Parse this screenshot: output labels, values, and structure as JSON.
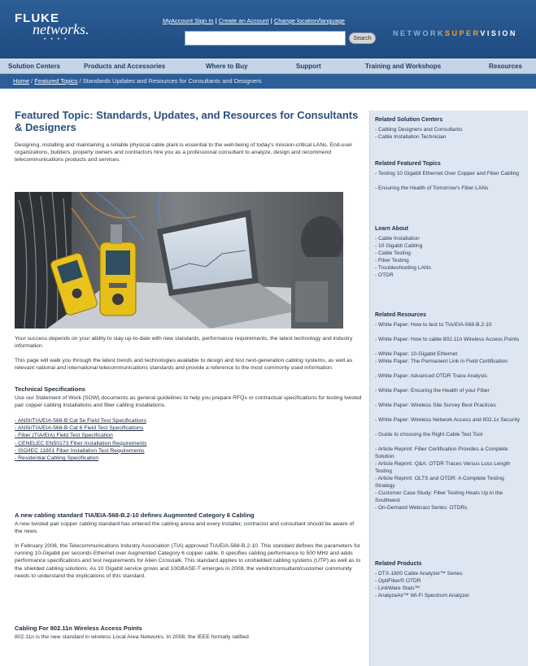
{
  "header": {
    "logo_top": "FLUKE",
    "logo_bottom": "networks.",
    "logo_dots": "• • • •",
    "links": [
      {
        "label": "MyAccount Sign In"
      },
      {
        "label": "Create an Account"
      },
      {
        "label": "Change location/language"
      }
    ],
    "link_separator": " | ",
    "search_placeholder": "",
    "search_button": "Search",
    "nsv_prefix": "NETWORK",
    "nsv_super": "SUPER",
    "nsv_vision": "VISION"
  },
  "nav": {
    "items": [
      "Solution Centers",
      "Products and Accessories",
      "Where to Buy",
      "Support",
      "Training and Workshops",
      "Resources"
    ]
  },
  "breadcrumb": {
    "home": "Home",
    "sep": " / ",
    "featured": "Featured Topics",
    "current": "Standards Updates and Resources for Consultants and Designers"
  },
  "main": {
    "title": "Featured Topic: Standards, Updates, and Resources for Consultants & Designers",
    "intro": "Designing, installing and maintaining a reliable physical cable plant is essential to the well-being of today's mission-critical LANs. End-user organizations, builders, property owners and contractors hire you as a professional consultant to analyze, design and recommend telecommunications products and services.",
    "p1": "Your success depends on your ability to stay up-to-date with new standards, performance requirements, the latest technology and industry information.",
    "p2": "This page will walk you through the latest trends and technologies available to design and test next-generation cabling systems, as well as relevant national and international telecommunications standards and provide a reference to the most commonly used information.",
    "tech_title": "Technical Specifications",
    "tech_body": "Use our Statement of Work (SOW) documents as general guidelines to help you prepare RFQs or contractual specifications for testing twisted pair copper cabling installations and fiber cabling installations.",
    "tech_links": [
      "- ANSI/TIA/EIA-568-B Cat 5e Field Test Specifications",
      "- ANSI/TIA/EIA-568-B Cat 6 Field Test Specifications",
      "- Fiber (TIA/EIA) Field Test Specification",
      "- CENELEC EN50173 Fiber Installation Requirements",
      "- ISO/IEC 11801 Fiber Installation Test Requirements",
      "- Residential Cabling Specification"
    ],
    "cat6_title": "A new cabling standard TIA/EIA-568-B.2-10 defines Augmented Category 6 Cabling",
    "cat6_body": "A new twisted pair copper cabling standard has entered the cabling arena and every installer, contractor and consultant should be aware of the news.",
    "cat6_body2": "In February 2008, the Telecommunications Industry Association (TIA) approved TIA/EIA-568-B.2-10. This standard defines the parameters for running 10-Gigabit per seconds Ethernet over Augmented Category 6 copper cable. It specifies cabling performance to 500 MHz and adds performance specifications and test requirements for Alien Crosstalk. This standard applies to unshielded cabling systems (UTP) as well as to the shielded cabling solutions. As 10 Gigabit service grows and 10GBASE-T emerges in 2008, the vendor/consultant/customer community needs to understand the implications of this standard.",
    "wifi_title": "Cabling For 802.11n Wireless Access Points",
    "wifi_body": "802.11n is the new standard in wireless Local Area Networks. In 2008, the IEEE formally ratified"
  },
  "sidebar": {
    "sections": [
      {
        "title": "Related Solution Centers",
        "items": [
          "- Cabling Designers and Consultants",
          "- Cable Installation Technician"
        ]
      },
      {
        "title": "Related Featured Topics",
        "items": [
          "- Testing 10 Gigabit Ethernet Over Copper and Fiber Cabling",
          "- Ensuring the Health of Tomorrow's Fiber LANs"
        ]
      },
      {
        "title": "Learn About",
        "items": [
          "- Cable Installation",
          "- 10 Gigabit Cabling",
          "- Cable Testing",
          "- Fiber Testing",
          "- Troubleshooting LANs",
          "- OTDR"
        ]
      },
      {
        "title": "Related Resources",
        "items": [
          "- White Paper: How to test to TIA/EIA-568-B.2-10",
          "- White Paper: How to cable 802.11n Wireless Access Points",
          "- White Paper: 10-Gigabit Ethernet",
          "- White Paper: The Permanent Link in Field Certification",
          "- White Paper: Advanced OTDR Trace Analysis",
          "- White Paper: Ensuring the Health of your Fiber",
          "- White Paper: Wireless Site Survey Best Practices",
          "- White Paper: Wireless Network Access and 802.1x Security",
          "- Guide to choosing the Right Cable Test Tool",
          "- Article Reprint: Fiber Certification Provides a Complete Solution",
          "- Article Reprint: Q&A: OTDR Traces Versus Loss Length Testing",
          "- Article Reprint: OLTS and OTDR: A Complete Testing Strategy",
          "- Customer Case Study: Fiber Testing Heats Up in the Southwest",
          "- On-Demand Webcast Series: OTDRs"
        ]
      },
      {
        "title": "Related Products",
        "items": [
          "- DTX-1800 Cable Analyzer™ Series",
          "- OptiFiber® OTDR",
          "- LinkWare Stats™",
          "- AnalyzeAir™ Wi-Fi Spectrum Analyzer"
        ]
      }
    ]
  },
  "colors": {
    "header_blue": "#2c5f98",
    "nav_light": "#c5d4e6",
    "title_blue": "#2b4f7e",
    "sidebar_bg": "#dde6f1",
    "accent_orange": "#f0a030"
  }
}
